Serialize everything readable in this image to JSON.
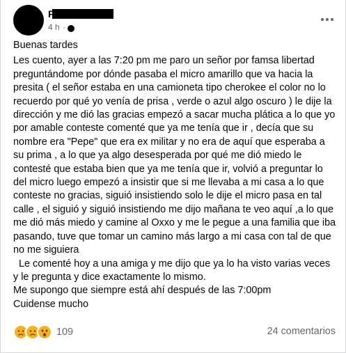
{
  "post": {
    "author": {
      "name_visible": "F"
    },
    "meta": {
      "time": "4 h",
      "separator": "·"
    },
    "body": {
      "greeting": "Buenas tardes",
      "paragraph": "Les cuento, ayer a las 7:20 pm me paro un señor por famsa libertad preguntándome por dónde pasaba el micro amarillo que va hacia la presita  ( el señor estaba en una camioneta tipo cherokee el color no lo recuerdo por qué yo venía de prisa , verde o azul algo oscuro )  le dije la dirección y me dió las gracias empezó a sacar mucha plática a lo que yo por amable conteste comenté que ya  me tenía que ir , decía que su nombre era \"Pepe\" que era ex militar y no era de aquí que esperaba a su prima  , a lo que ya algo desesperada por qué me dió miedo le contesté que estaba bien que ya me tenía que ir, volvió a preguntar lo del micro luego empezó a insistir que si me llevaba a mi casa a lo que conteste no gracias, siguió insistiendo solo le dije el micro pasa en tal calle , el siguió y siguió insistiendo me dijo mañana te veo aquí ,a lo que me dió más miedo y camine al Oxxo y me le pegue a una familia que iba pasando, tuve que tomar un camino más largo a mi casa con tal de que no me siguiera",
      "paragraph_2": "  Le comenté hoy a una amiga y me dijo que ya lo ha visto varias veces y le pregunta y dice exactamente lo mismo.",
      "line_3": "Me supongo que siempre está ahí después de las 7:00pm",
      "line_4": "Cuidense mucho"
    },
    "reactions": {
      "icons": [
        "sad-reaction-icon",
        "sad-reaction-icon",
        "wow-reaction-icon"
      ],
      "count": "109"
    },
    "comments": {
      "label": "24 comentarios"
    },
    "colors": {
      "text": "#050505",
      "secondary": "#65676b",
      "reaction_yellow": "#f7b125"
    }
  }
}
